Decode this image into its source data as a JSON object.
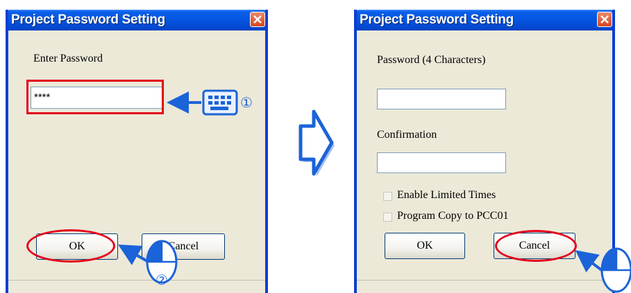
{
  "dialog1": {
    "title": "Project Password Setting",
    "label": "Enter Password",
    "password_value": "****",
    "ok_label": "OK",
    "cancel_label": "Cancel"
  },
  "dialog2": {
    "title": "Project Password Setting",
    "password_label": "Password (4 Characters)",
    "password_value": "",
    "confirmation_label": "Confirmation",
    "confirmation_value": "",
    "enable_limited_times_label": "Enable Limited Times",
    "enable_limited_times_checked": false,
    "program_copy_label": "Program Copy to PCC01",
    "program_copy_checked": false,
    "ok_label": "OK",
    "cancel_label": "Cancel"
  },
  "annotations": {
    "step1_marker": "①",
    "step2_marker": "②",
    "highlight_color": "#e4001b",
    "arrow_color": "#1b63d8",
    "step1_icon": "keyboard-icon",
    "step2_icon": "mouse-icon",
    "transition_icon": "right-arrow-icon"
  }
}
